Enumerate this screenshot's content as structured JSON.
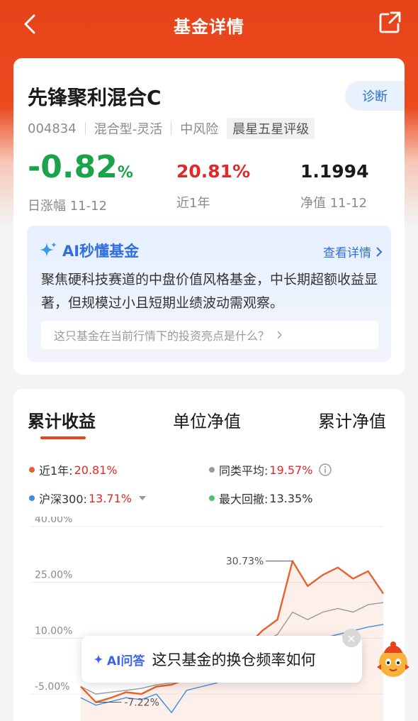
{
  "nav": {
    "title": "基金详情",
    "back_icon": "chevron-left-icon",
    "share_icon": "share-icon"
  },
  "fund": {
    "name": "先锋聚利混合C",
    "diagnose_label": "诊断",
    "code": "004834",
    "type": "混合型-灵活",
    "risk": "中风险",
    "rating": "晨星五星评级"
  },
  "metrics": {
    "daily_change": "-0.82",
    "daily_change_unit": "%",
    "daily_label": "日涨幅 11-12",
    "one_year": "20.81%",
    "one_year_label": "近1年",
    "nav_value": "1.1994",
    "nav_label": "净值 11-12"
  },
  "ai_summary": {
    "title": "AI秒懂基金",
    "more": "查看详情",
    "text": "聚焦硬科技赛道的中盘价值风格基金，中长期超额收益显著，但规模过小且短期业绩波动需观察。",
    "question": "这只基金在当前行情下的投资亮点是什么？"
  },
  "tabs": [
    "累计收益",
    "单位净值",
    "累计净值"
  ],
  "legend": {
    "fund_label": "近1年:",
    "fund_value": "20.81%",
    "peer_label": "同类平均:",
    "peer_value": "19.57%",
    "index_label": "沪深300:",
    "index_value": "13.71%",
    "dd_label": "最大回撤:",
    "dd_value": "13.35%"
  },
  "colors": {
    "brand": "#e8431a",
    "fund": "#e8622e",
    "peer": "#9a9a9a",
    "index": "#3b8ee0",
    "drawdown": "#4cc46a",
    "down": "#1aa34a",
    "up": "#e02a2a"
  },
  "chart_data": {
    "type": "line",
    "y_ticks": [
      "40.00%",
      "25.00%",
      "10.00%",
      "-5.00%"
    ],
    "ylim": [
      -10,
      40
    ],
    "annotations": [
      "30.73%",
      "-7.22%"
    ],
    "series": [
      {
        "values": [
          -3,
          -7.2,
          -6,
          -4.5,
          -5,
          -3,
          -2.5,
          -1,
          0,
          2,
          4,
          8,
          12,
          15,
          30.73,
          24,
          27,
          29,
          26,
          28,
          22
        ]
      },
      {
        "values": [
          -3,
          -5,
          -4.5,
          -4,
          -3.5,
          -2.5,
          -2,
          -1,
          0,
          1,
          3,
          6,
          9,
          11,
          17,
          15,
          17,
          18,
          17,
          19,
          19.57
        ]
      },
      {
        "values": [
          -6,
          -8,
          -7,
          -6,
          -6.5,
          -5,
          -10,
          -4,
          -3,
          -2,
          0,
          2,
          5,
          7,
          10,
          8,
          10,
          11,
          12,
          13,
          13.71
        ]
      }
    ]
  },
  "ai_float": {
    "tag": "AI问答",
    "question": "这只基金的换仓频率如何",
    "close": "×"
  }
}
